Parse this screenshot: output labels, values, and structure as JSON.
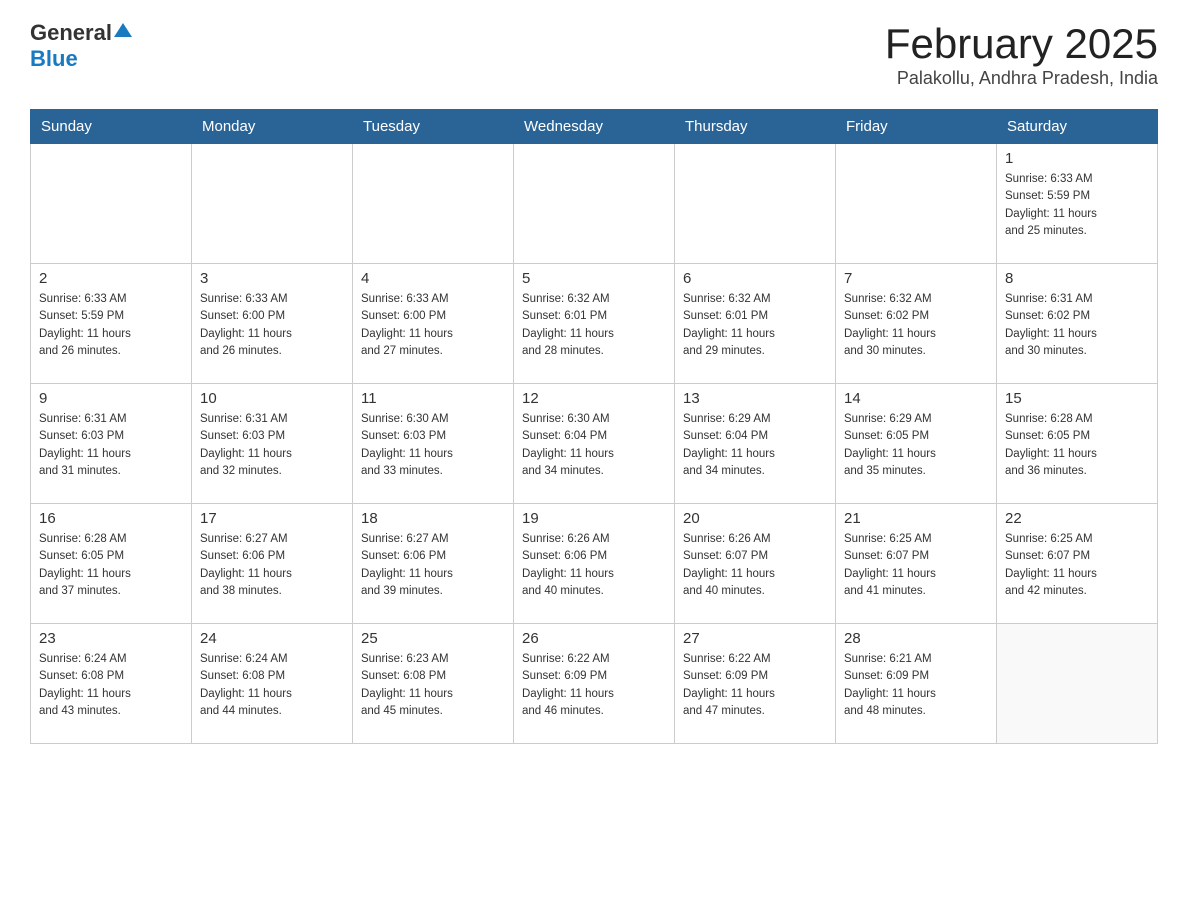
{
  "header": {
    "logo_general": "General",
    "logo_blue": "Blue",
    "title": "February 2025",
    "subtitle": "Palakollu, Andhra Pradesh, India"
  },
  "weekdays": [
    "Sunday",
    "Monday",
    "Tuesday",
    "Wednesday",
    "Thursday",
    "Friday",
    "Saturday"
  ],
  "weeks": [
    [
      {
        "day": "",
        "info": ""
      },
      {
        "day": "",
        "info": ""
      },
      {
        "day": "",
        "info": ""
      },
      {
        "day": "",
        "info": ""
      },
      {
        "day": "",
        "info": ""
      },
      {
        "day": "",
        "info": ""
      },
      {
        "day": "1",
        "info": "Sunrise: 6:33 AM\nSunset: 5:59 PM\nDaylight: 11 hours\nand 25 minutes."
      }
    ],
    [
      {
        "day": "2",
        "info": "Sunrise: 6:33 AM\nSunset: 5:59 PM\nDaylight: 11 hours\nand 26 minutes."
      },
      {
        "day": "3",
        "info": "Sunrise: 6:33 AM\nSunset: 6:00 PM\nDaylight: 11 hours\nand 26 minutes."
      },
      {
        "day": "4",
        "info": "Sunrise: 6:33 AM\nSunset: 6:00 PM\nDaylight: 11 hours\nand 27 minutes."
      },
      {
        "day": "5",
        "info": "Sunrise: 6:32 AM\nSunset: 6:01 PM\nDaylight: 11 hours\nand 28 minutes."
      },
      {
        "day": "6",
        "info": "Sunrise: 6:32 AM\nSunset: 6:01 PM\nDaylight: 11 hours\nand 29 minutes."
      },
      {
        "day": "7",
        "info": "Sunrise: 6:32 AM\nSunset: 6:02 PM\nDaylight: 11 hours\nand 30 minutes."
      },
      {
        "day": "8",
        "info": "Sunrise: 6:31 AM\nSunset: 6:02 PM\nDaylight: 11 hours\nand 30 minutes."
      }
    ],
    [
      {
        "day": "9",
        "info": "Sunrise: 6:31 AM\nSunset: 6:03 PM\nDaylight: 11 hours\nand 31 minutes."
      },
      {
        "day": "10",
        "info": "Sunrise: 6:31 AM\nSunset: 6:03 PM\nDaylight: 11 hours\nand 32 minutes."
      },
      {
        "day": "11",
        "info": "Sunrise: 6:30 AM\nSunset: 6:03 PM\nDaylight: 11 hours\nand 33 minutes."
      },
      {
        "day": "12",
        "info": "Sunrise: 6:30 AM\nSunset: 6:04 PM\nDaylight: 11 hours\nand 34 minutes."
      },
      {
        "day": "13",
        "info": "Sunrise: 6:29 AM\nSunset: 6:04 PM\nDaylight: 11 hours\nand 34 minutes."
      },
      {
        "day": "14",
        "info": "Sunrise: 6:29 AM\nSunset: 6:05 PM\nDaylight: 11 hours\nand 35 minutes."
      },
      {
        "day": "15",
        "info": "Sunrise: 6:28 AM\nSunset: 6:05 PM\nDaylight: 11 hours\nand 36 minutes."
      }
    ],
    [
      {
        "day": "16",
        "info": "Sunrise: 6:28 AM\nSunset: 6:05 PM\nDaylight: 11 hours\nand 37 minutes."
      },
      {
        "day": "17",
        "info": "Sunrise: 6:27 AM\nSunset: 6:06 PM\nDaylight: 11 hours\nand 38 minutes."
      },
      {
        "day": "18",
        "info": "Sunrise: 6:27 AM\nSunset: 6:06 PM\nDaylight: 11 hours\nand 39 minutes."
      },
      {
        "day": "19",
        "info": "Sunrise: 6:26 AM\nSunset: 6:06 PM\nDaylight: 11 hours\nand 40 minutes."
      },
      {
        "day": "20",
        "info": "Sunrise: 6:26 AM\nSunset: 6:07 PM\nDaylight: 11 hours\nand 40 minutes."
      },
      {
        "day": "21",
        "info": "Sunrise: 6:25 AM\nSunset: 6:07 PM\nDaylight: 11 hours\nand 41 minutes."
      },
      {
        "day": "22",
        "info": "Sunrise: 6:25 AM\nSunset: 6:07 PM\nDaylight: 11 hours\nand 42 minutes."
      }
    ],
    [
      {
        "day": "23",
        "info": "Sunrise: 6:24 AM\nSunset: 6:08 PM\nDaylight: 11 hours\nand 43 minutes."
      },
      {
        "day": "24",
        "info": "Sunrise: 6:24 AM\nSunset: 6:08 PM\nDaylight: 11 hours\nand 44 minutes."
      },
      {
        "day": "25",
        "info": "Sunrise: 6:23 AM\nSunset: 6:08 PM\nDaylight: 11 hours\nand 45 minutes."
      },
      {
        "day": "26",
        "info": "Sunrise: 6:22 AM\nSunset: 6:09 PM\nDaylight: 11 hours\nand 46 minutes."
      },
      {
        "day": "27",
        "info": "Sunrise: 6:22 AM\nSunset: 6:09 PM\nDaylight: 11 hours\nand 47 minutes."
      },
      {
        "day": "28",
        "info": "Sunrise: 6:21 AM\nSunset: 6:09 PM\nDaylight: 11 hours\nand 48 minutes."
      },
      {
        "day": "",
        "info": ""
      }
    ]
  ]
}
